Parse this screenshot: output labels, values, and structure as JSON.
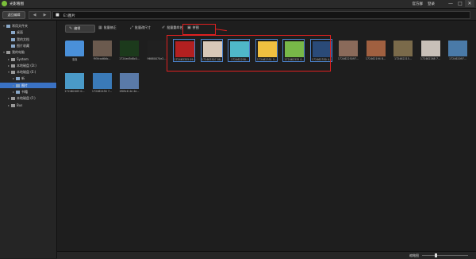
{
  "app": {
    "title": "光影看图",
    "header_links": [
      "官方群",
      "登录"
    ],
    "window_buttons": [
      "—",
      "□",
      "✕"
    ]
  },
  "nav": {
    "back_label": "返回编辑",
    "path": "E:\\图片"
  },
  "sidebar": {
    "items": [
      {
        "label": "常用文件夹",
        "level": 0,
        "toggle": "▾",
        "icon": "folder-icon"
      },
      {
        "label": "桌面",
        "level": 1,
        "toggle": "",
        "icon": "folder-icon"
      },
      {
        "label": "我的文档",
        "level": 1,
        "toggle": "",
        "icon": "folder-icon"
      },
      {
        "label": "图片收藏",
        "level": 1,
        "toggle": "",
        "icon": "folder-icon"
      },
      {
        "label": "我的电脑",
        "level": 0,
        "toggle": "▾",
        "icon": "disk-icon"
      },
      {
        "label": "System",
        "level": 1,
        "toggle": "▸",
        "icon": "disk-icon"
      },
      {
        "label": "本地磁盘 (D:)",
        "level": 1,
        "toggle": "▸",
        "icon": "disk-icon"
      },
      {
        "label": "本地磁盘 (E:)",
        "level": 1,
        "toggle": "▾",
        "icon": "disk-icon"
      },
      {
        "label": "新",
        "level": 2,
        "toggle": "▸",
        "icon": "folder-icon"
      },
      {
        "label": "图片",
        "level": 2,
        "toggle": "▸",
        "icon": "folder-icon",
        "selected": true
      },
      {
        "label": "书籍",
        "level": 2,
        "toggle": "▸",
        "icon": "folder-icon"
      },
      {
        "label": "本地磁盘 (F:)",
        "level": 1,
        "toggle": "▸",
        "icon": "disk-icon"
      },
      {
        "label": "Bus",
        "level": 1,
        "toggle": "▸",
        "icon": "disk-icon"
      }
    ]
  },
  "toolbar": {
    "buttons": [
      {
        "label": "编辑",
        "icon": "pencil-icon"
      },
      {
        "label": "批量修正",
        "icon": "batch-edit-icon"
      },
      {
        "label": "批量改尺寸",
        "icon": "resize-icon"
      },
      {
        "label": "批量重命名",
        "icon": "rename-icon"
      },
      {
        "label": "拼图",
        "icon": "puzzle-icon"
      }
    ]
  },
  "thumbnails": [
    {
      "caption": "泡泡",
      "kind": "folder",
      "color": "#4a90d9",
      "selected": false
    },
    {
      "caption": "f95fcad6db...",
      "kind": "image",
      "color": "#6b5a4e",
      "selected": false
    },
    {
      "caption": "1724ed5d8c0...",
      "kind": "image",
      "color": "#1c3a1c",
      "selected": false
    },
    {
      "caption": "96680070e2...",
      "kind": "image",
      "color": "#202020",
      "selected": false
    },
    {
      "caption": "172463355 09...",
      "kind": "image",
      "color": "#b32020",
      "selected": true
    },
    {
      "caption": "172463307 08...",
      "kind": "image",
      "color": "#d8c8b8",
      "selected": true
    },
    {
      "caption": "172462258...",
      "kind": "image",
      "color": "#4fb8c8",
      "selected": true
    },
    {
      "caption": "172462351 5...",
      "kind": "image",
      "color": "#f0c040",
      "selected": true
    },
    {
      "caption": "172462335 0...",
      "kind": "image",
      "color": "#78b848",
      "selected": true
    },
    {
      "caption": "172462330 4...",
      "kind": "image",
      "color": "#2a4a78",
      "selected": true
    },
    {
      "caption": "17246225097...",
      "kind": "image",
      "color": "#8a6a5a",
      "selected": false
    },
    {
      "caption": "172462194 8...",
      "kind": "image",
      "color": "#a06040",
      "selected": false
    },
    {
      "caption": "172462215...",
      "kind": "image",
      "color": "#7a6a4a",
      "selected": false
    },
    {
      "caption": "172462268 7...",
      "kind": "image",
      "color": "#c8c0b8",
      "selected": false
    },
    {
      "caption": "172462097...",
      "kind": "image",
      "color": "#4a7aa8",
      "selected": false
    },
    {
      "caption": "172462405 0...",
      "kind": "image",
      "color": "#4a9ac8",
      "selected": false
    },
    {
      "caption": "172462450 7...",
      "kind": "image",
      "color": "#3a7ab8",
      "selected": false
    },
    {
      "caption": "0f09c6 4e 4e...",
      "kind": "image",
      "color": "#5a7aa8",
      "selected": false
    }
  ],
  "status": {
    "zoom_label": "缩略图",
    "zoom_level": 0.3
  },
  "colors": {
    "annotation": "#e02020",
    "selection": "#3a72c4"
  }
}
